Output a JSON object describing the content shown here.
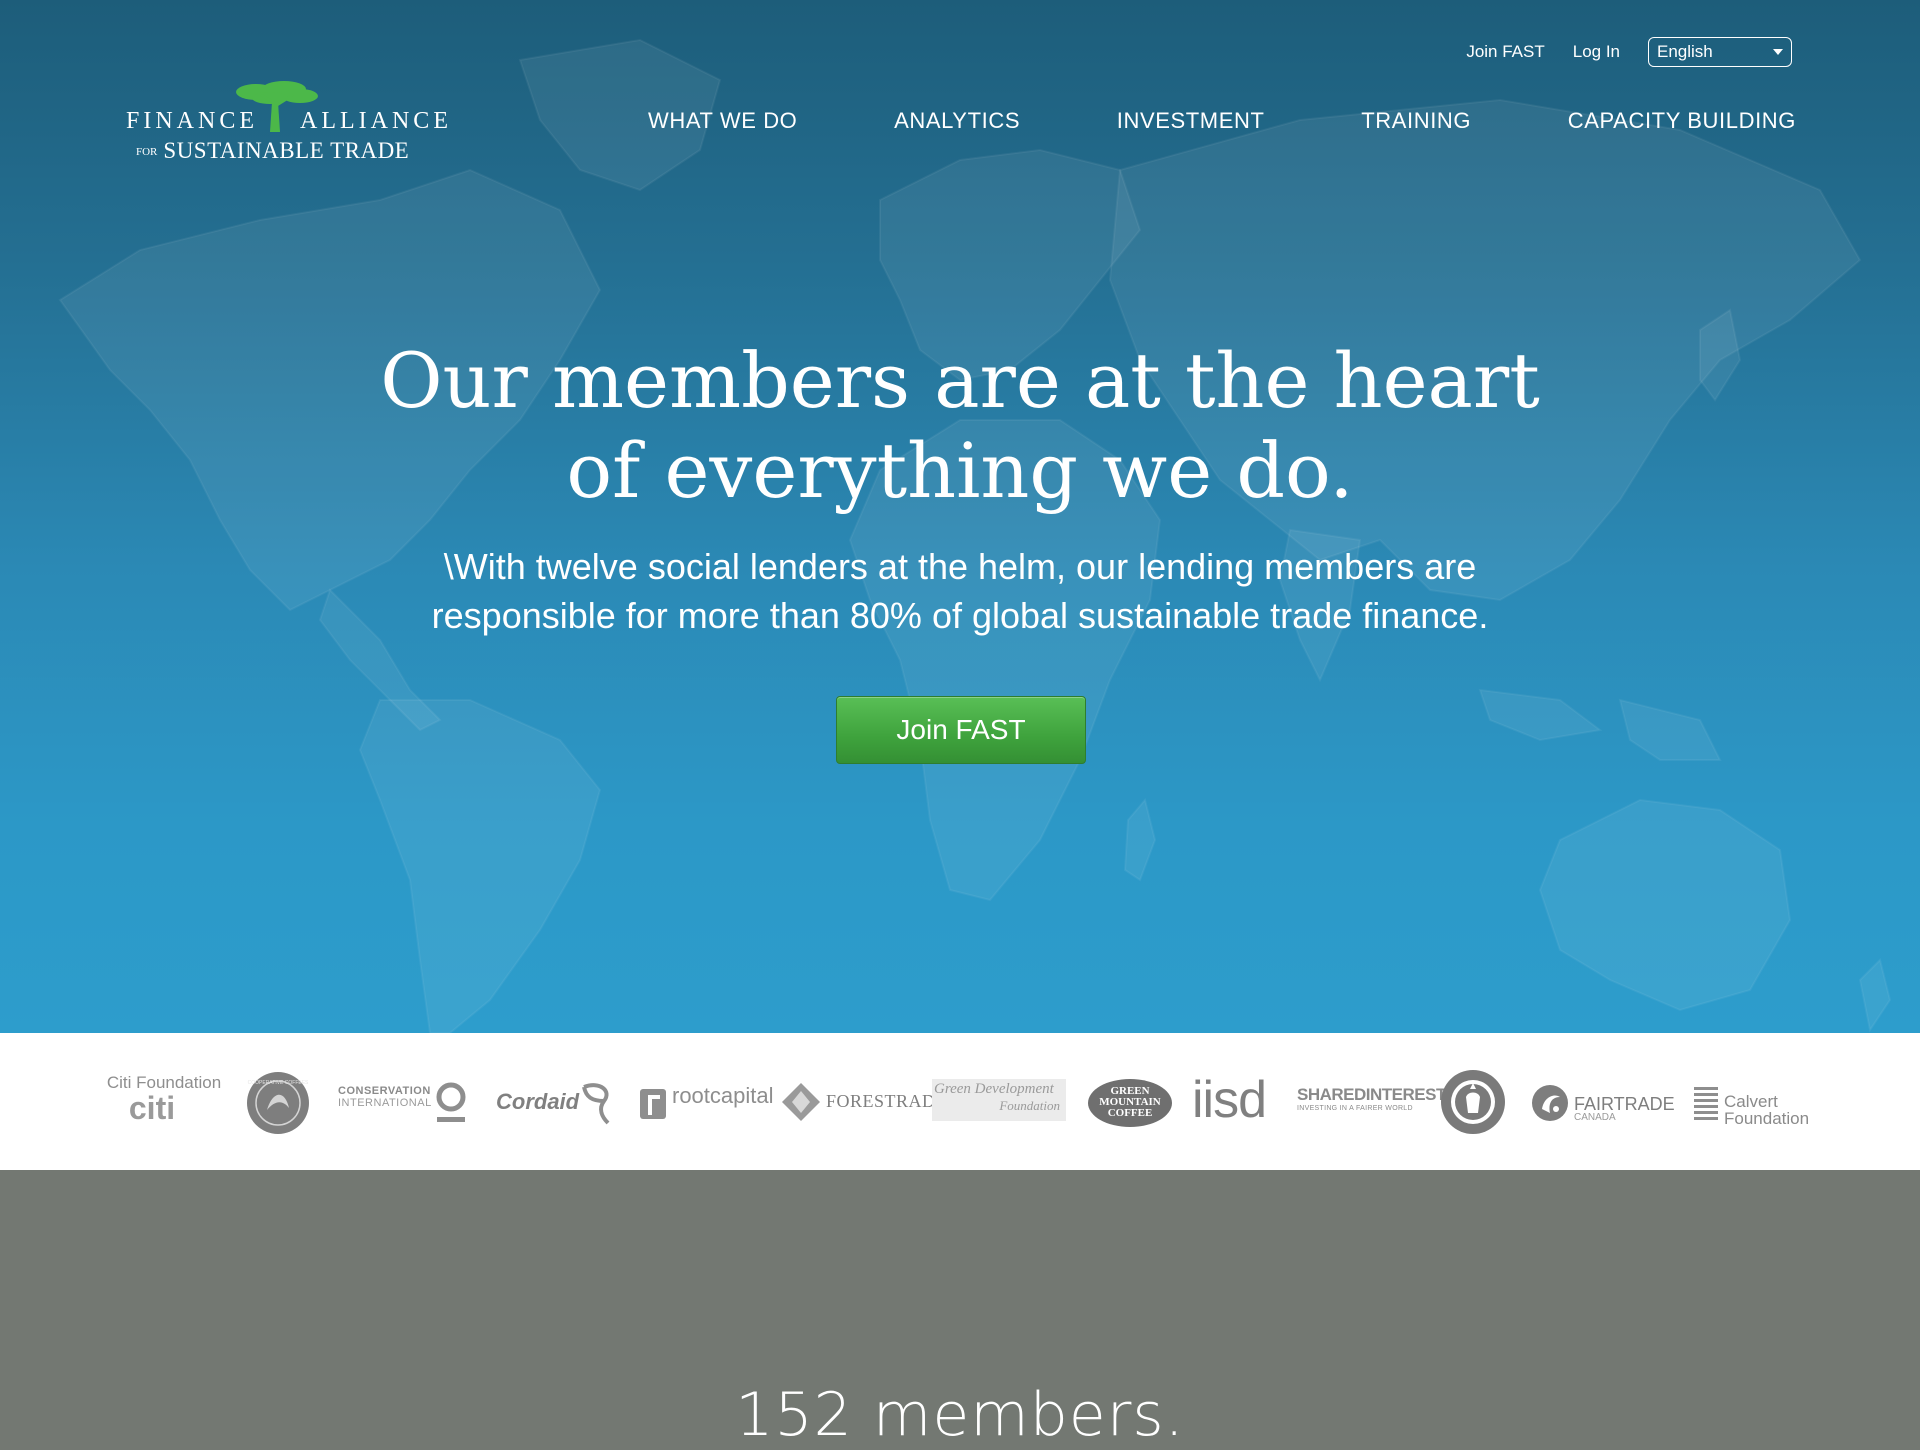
{
  "header": {
    "logo": {
      "line1_left": "FINANCE",
      "line1_right": "ALLIANCE",
      "line2_prefix": "FOR",
      "line2": "SUSTAINABLE TRADE"
    },
    "top_links": [
      "Join FAST",
      "Log In"
    ],
    "language": {
      "selected": "English"
    },
    "nav": [
      "WHAT WE DO",
      "ANALYTICS",
      "INVESTMENT",
      "TRAINING",
      "CAPACITY BUILDING"
    ]
  },
  "hero": {
    "headline_line1": "Our members are at the heart",
    "headline_line2": "of everything we do.",
    "subline_line1": "\\With twelve social lenders at the helm, our lending members are",
    "subline_line2": "responsible for more than 80% of global sustainable trade finance.",
    "cta": "Join FAST"
  },
  "partners": {
    "citi": {
      "top": "Citi Foundation",
      "bottom": "citi"
    },
    "coop_coffees": "COOPERATIVE COFFEES",
    "conservation": {
      "line1": "CONSERVATION",
      "line2": "INTERNATIONAL"
    },
    "cordaid": "Cordaid",
    "rootcapital": "rootcapital",
    "forestrade": "FORESTRADE",
    "green_dev": {
      "line1": "Green Development",
      "line2": "Foundation"
    },
    "gmc": {
      "line1": "GREEN",
      "line2": "MOUNTAIN",
      "line3": "COFFEE"
    },
    "iisd": "iisd",
    "shared_interest": {
      "line1": "SHAREDINTEREST",
      "line2": "INVESTING IN A FAIRER WORLD"
    },
    "fairtrade": {
      "line1": "FAIRTRADE",
      "line2": "CANADA"
    },
    "calvert": {
      "line1": "Calvert",
      "line2": "Foundation"
    }
  },
  "stats": {
    "members": "152 members."
  },
  "colors": {
    "hero_top": "#1d5d7a",
    "hero_bottom": "#2d9dcc",
    "cta_green": "#3fa33d",
    "logo_tree": "#4cb849",
    "stats_bg": "#737872",
    "partner_gray": "#8e8e8e"
  }
}
